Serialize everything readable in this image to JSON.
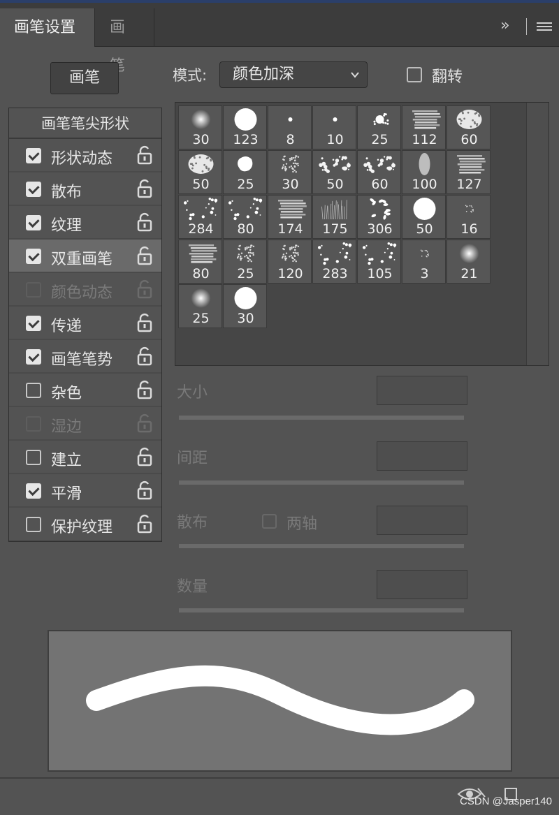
{
  "tabs": [
    {
      "label": "画笔设置",
      "active": true
    },
    {
      "label": "画笔",
      "active": false
    }
  ],
  "toolbar": {
    "expand_icon": "double-chevron-right-icon",
    "menu_icon": "hamburger-menu-icon"
  },
  "brush_button": "画笔",
  "mode": {
    "label": "模式:",
    "value": "颜色加深"
  },
  "flip": {
    "label": "翻转",
    "checked": false
  },
  "tip_shape_label": "画笔笔尖形状",
  "options": [
    {
      "label": "形状动态",
      "checked": true,
      "enabled": true,
      "selected": false
    },
    {
      "label": "散布",
      "checked": true,
      "enabled": true,
      "selected": false
    },
    {
      "label": "纹理",
      "checked": true,
      "enabled": true,
      "selected": false
    },
    {
      "label": "双重画笔",
      "checked": true,
      "enabled": true,
      "selected": true
    },
    {
      "label": "颜色动态",
      "checked": false,
      "enabled": false,
      "selected": false
    },
    {
      "label": "传递",
      "checked": true,
      "enabled": true,
      "selected": false
    },
    {
      "label": "画笔笔势",
      "checked": true,
      "enabled": true,
      "selected": false
    },
    {
      "label": "杂色",
      "checked": false,
      "enabled": true,
      "selected": false
    },
    {
      "label": "湿边",
      "checked": false,
      "enabled": false,
      "selected": false
    },
    {
      "label": "建立",
      "checked": false,
      "enabled": true,
      "selected": false
    },
    {
      "label": "平滑",
      "checked": true,
      "enabled": true,
      "selected": false
    },
    {
      "label": "保护纹理",
      "checked": false,
      "enabled": true,
      "selected": false
    }
  ],
  "presets": [
    {
      "size": "30",
      "kind": "soft"
    },
    {
      "size": "123",
      "kind": "hard"
    },
    {
      "size": "8",
      "kind": "dot"
    },
    {
      "size": "10",
      "kind": "dot"
    },
    {
      "size": "25",
      "kind": "splat"
    },
    {
      "size": "112",
      "kind": "chalk"
    },
    {
      "size": "60",
      "kind": "sponge"
    },
    {
      "size": "50",
      "kind": "sponge"
    },
    {
      "size": "25",
      "kind": "blob"
    },
    {
      "size": "30",
      "kind": "fuzzy"
    },
    {
      "size": "50",
      "kind": "leafy"
    },
    {
      "size": "60",
      "kind": "leafy"
    },
    {
      "size": "100",
      "kind": "oval"
    },
    {
      "size": "127",
      "kind": "chalk"
    },
    {
      "size": "284",
      "kind": "scatter"
    },
    {
      "size": "80",
      "kind": "scatter"
    },
    {
      "size": "174",
      "kind": "chalk"
    },
    {
      "size": "175",
      "kind": "grass"
    },
    {
      "size": "306",
      "kind": "leaves"
    },
    {
      "size": "50",
      "kind": "hard"
    },
    {
      "size": "16",
      "kind": "tiny"
    },
    {
      "size": "80",
      "kind": "chalk"
    },
    {
      "size": "25",
      "kind": "fuzzy"
    },
    {
      "size": "120",
      "kind": "fuzzy"
    },
    {
      "size": "283",
      "kind": "scatter"
    },
    {
      "size": "105",
      "kind": "scatter"
    },
    {
      "size": "3",
      "kind": "tiny"
    },
    {
      "size": "21",
      "kind": "soft"
    },
    {
      "size": "25",
      "kind": "soft"
    },
    {
      "size": "30",
      "kind": "hard"
    }
  ],
  "sliders": [
    {
      "label": "大小"
    },
    {
      "label": "间距"
    },
    {
      "label": "散布"
    },
    {
      "label": "数量"
    }
  ],
  "scatter_both_axes": {
    "label": "两轴",
    "checked": false
  },
  "footer": {
    "eye_icon": "eye-toggle-icon",
    "new_icon": "create-new-brush-icon"
  },
  "watermark": "CSDN @Jasper140"
}
